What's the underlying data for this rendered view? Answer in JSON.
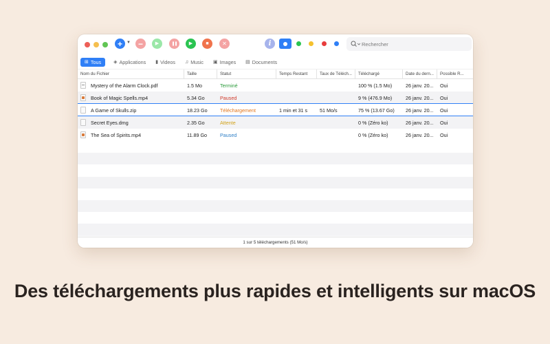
{
  "window": {
    "traffic_lights": [
      "#ed5f57",
      "#f5bf4f",
      "#61c554"
    ],
    "toolbar": {
      "buttons": [
        {
          "name": "add-icon",
          "color": "#2f7ff6",
          "glyph": "+"
        },
        {
          "name": "remove-icon",
          "color": "#f4a3a3",
          "glyph": "−"
        },
        {
          "name": "resume-icon",
          "color": "#9be7a8",
          "glyph": "▶"
        },
        {
          "name": "pause-icon",
          "color": "#f4a3a3",
          "glyph": "❚❚"
        },
        {
          "name": "start-all-icon",
          "color": "#2ac451",
          "glyph": "▶"
        },
        {
          "name": "stop-icon",
          "color": "#f0734c",
          "glyph": "■"
        },
        {
          "name": "clear-icon",
          "color": "#f4a3a3",
          "glyph": "✕"
        }
      ],
      "info_glyph": "i",
      "color_filters": [
        "#2ac451",
        "#f5c12e",
        "#e83d3d",
        "#2f7ff6"
      ],
      "search_placeholder": "Rechercher"
    },
    "tabs": [
      {
        "label": "Tous",
        "icon": "grid-icon",
        "glyph": "⊞",
        "active": true
      },
      {
        "label": "Applications",
        "icon": "layers-icon",
        "glyph": "◈",
        "active": false
      },
      {
        "label": "Videos",
        "icon": "video-icon",
        "glyph": "▮",
        "active": false
      },
      {
        "label": "Music",
        "icon": "music-icon",
        "glyph": "♫",
        "active": false
      },
      {
        "label": "Images",
        "icon": "image-icon",
        "glyph": "▣",
        "active": false
      },
      {
        "label": "Documents",
        "icon": "document-icon",
        "glyph": "▤",
        "active": false
      }
    ],
    "table": {
      "columns": [
        "Nom du Fichier",
        "Taille",
        "Statut",
        "Temps Restant",
        "Taux de Téléch...",
        "Téléchargé",
        "Date du dern...",
        "Possible R..."
      ],
      "rows": [
        {
          "file_icon": "pdf",
          "name": "Mystery of the Alarm Clock.pdf",
          "size": "1.5 Mo",
          "status": "Terminé",
          "status_color": "#2a9a3a",
          "time_left": "",
          "rate": "",
          "downloaded": "100 % (1.5 Mo)",
          "date": "26 janv. 20...",
          "resume": "Oui"
        },
        {
          "file_icon": "video",
          "name": "Book of Magic Spells.mp4",
          "size": "5.34 Go",
          "status": "Paused",
          "status_color": "#d03a2a",
          "time_left": "",
          "rate": "",
          "downloaded": "9 % (476.9 Mo)",
          "date": "26 janv. 20...",
          "resume": "Oui"
        },
        {
          "file_icon": "archive",
          "name": "A Game of Skulls.zip",
          "size": "18.23 Go",
          "status": "Téléchargement",
          "status_color": "#e2751c",
          "time_left": "1 min et 31 s",
          "rate": "51 Mo/s",
          "downloaded": "75 % (13.67 Go)",
          "date": "26 janv. 20...",
          "resume": "Oui"
        },
        {
          "file_icon": "disk",
          "name": "Secret Eyes.dmg",
          "size": "2.35 Go",
          "status": "Attente",
          "status_color": "#d2a21a",
          "time_left": "",
          "rate": "",
          "downloaded": "0 % (Zéro ko)",
          "date": "26 janv. 20...",
          "resume": "Oui"
        },
        {
          "file_icon": "video",
          "name": "The Sea of Spirits.mp4",
          "size": "11.89 Go",
          "status": "Paused",
          "status_color": "#2f7fc6",
          "time_left": "",
          "rate": "",
          "downloaded": "0 % (Zéro ko)",
          "date": "26 janv. 20...",
          "resume": "Oui"
        }
      ]
    },
    "status_bar": "1 sur 5 téléchargements (51 Mo/s)"
  },
  "tagline": "Des téléchargements plus rapides et intelligents sur macOS"
}
